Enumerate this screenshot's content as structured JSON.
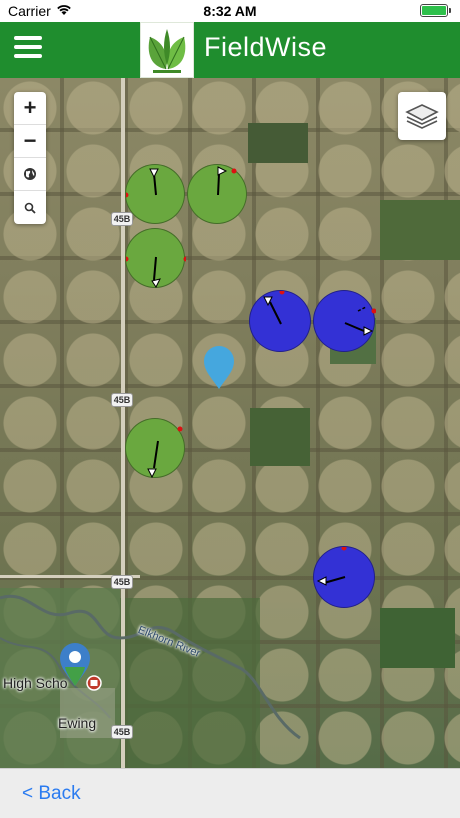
{
  "status_bar": {
    "carrier": "Carrier",
    "time": "8:32 AM"
  },
  "header": {
    "title": "FieldWise",
    "menu_icon": "hamburger-menu-icon",
    "logo_icon": "leaf-logo-icon",
    "color": "#1f8d2e"
  },
  "map_controls": {
    "zoom_in_label": "+",
    "zoom_out_label": "−",
    "locate_icon": "globe-icon",
    "search_icon": "search-icon",
    "layers_icon": "layers-icon"
  },
  "map": {
    "route_shields": [
      "45B",
      "45B",
      "45B",
      "45B"
    ],
    "river_label": "Elkhorn River",
    "place_labels": [
      "High Scho",
      "Ewing"
    ],
    "pivot_colors": {
      "green": "#6aa83f",
      "blue": "#3331d5"
    }
  },
  "footer": {
    "back_label": "< Back"
  }
}
